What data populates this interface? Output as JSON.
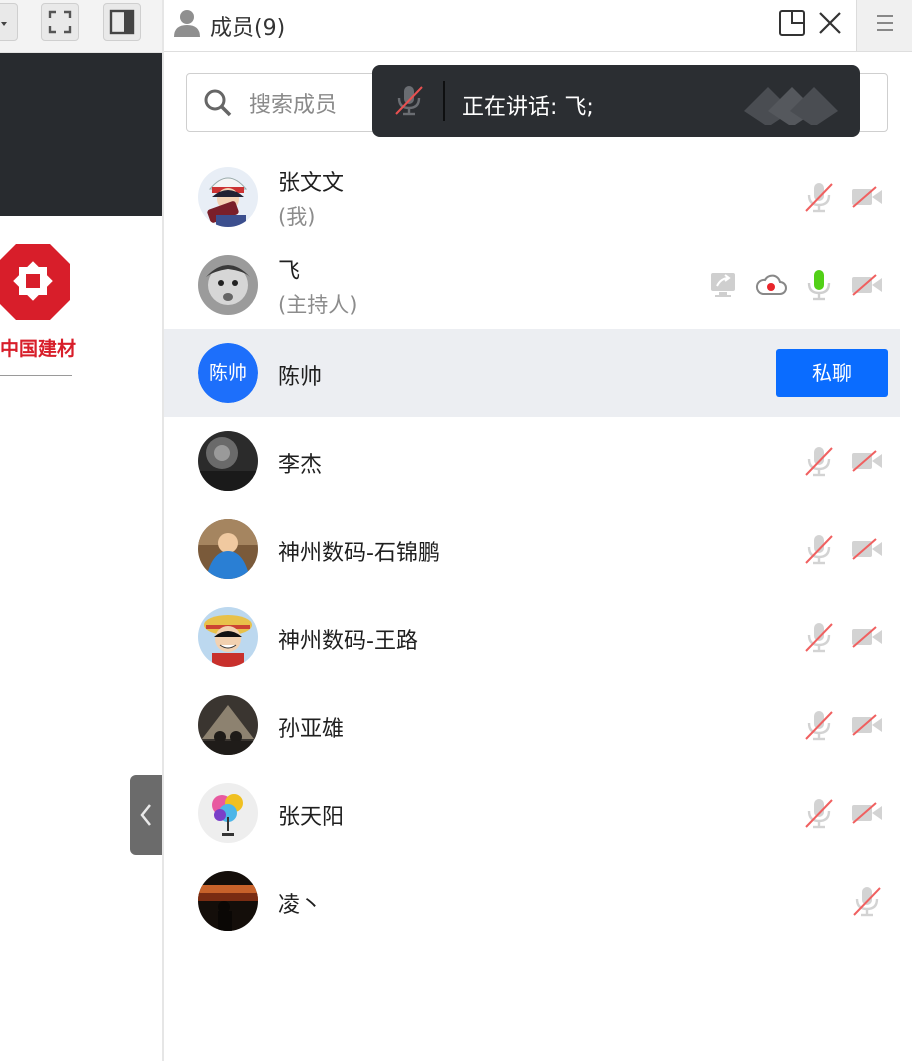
{
  "header": {
    "title": "成员(9)"
  },
  "search": {
    "placeholder": "搜索成员"
  },
  "toast": {
    "text": "正在讲话: 飞;"
  },
  "left_panel": {
    "logo_text": "中国建材"
  },
  "members": [
    {
      "name": "张文文",
      "role": "(我)"
    },
    {
      "name": "飞",
      "role": "(主持人)"
    },
    {
      "name": "陈帅",
      "avatar_text": "陈帅",
      "action_label": "私聊"
    },
    {
      "name": "李杰"
    },
    {
      "name": "神州数码-石锦鹏"
    },
    {
      "name": "神州数码-王路"
    },
    {
      "name": "孙亚雄"
    },
    {
      "name": "张天阳"
    },
    {
      "name": "凌丶"
    }
  ],
  "colors": {
    "accent": "#0a6cff",
    "speaking_mic": "#52d017",
    "muted_slash": "#f04545",
    "record_dot": "#e8262b",
    "logo_red": "#d81e2a"
  }
}
